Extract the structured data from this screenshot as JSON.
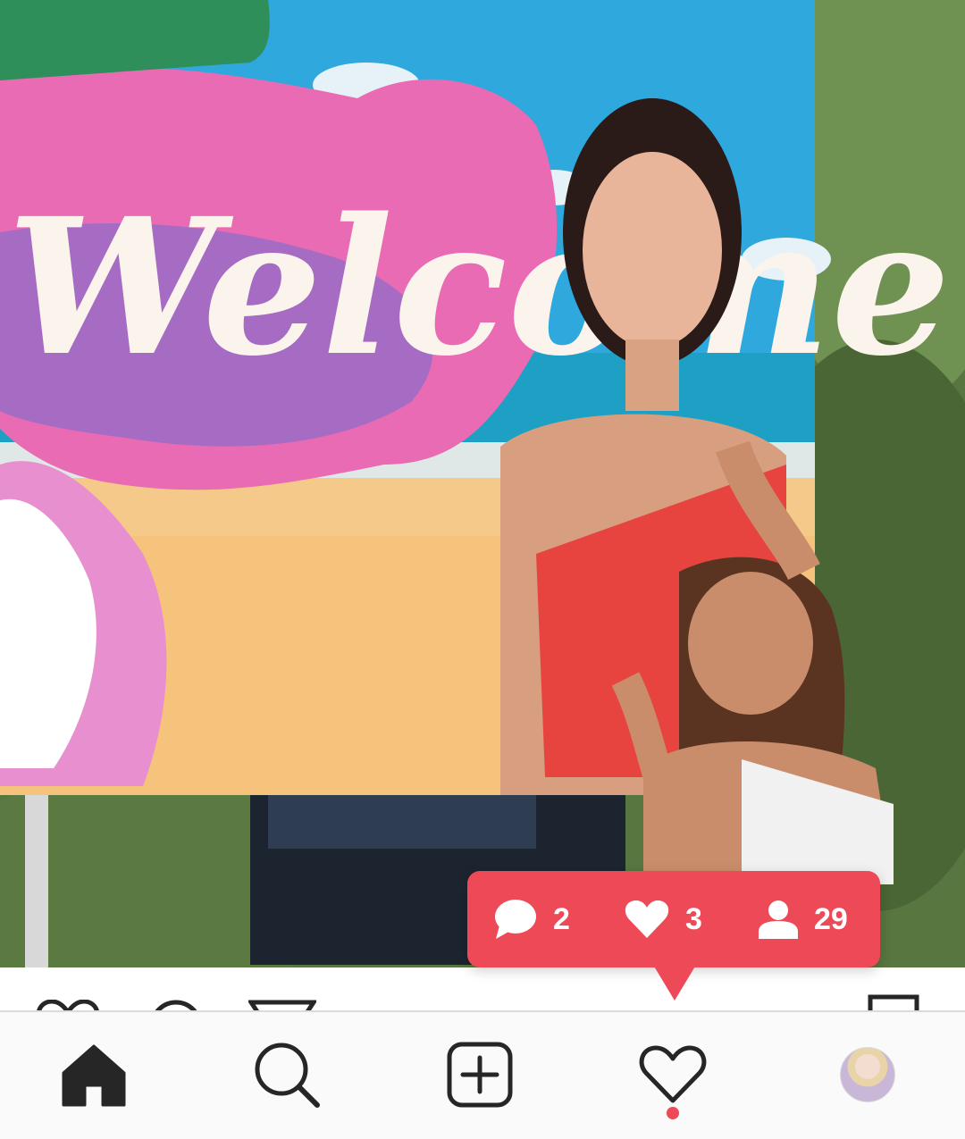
{
  "photo": {
    "sign_text": "Welcome",
    "colors": {
      "sky": "#2ea8dd",
      "sea": "#1e9fc4",
      "sand": "#f4c98a",
      "pink_splash": "#e86bb4",
      "purple_splash": "#9a6cc5",
      "swimsuit_red": "#e8443f",
      "foliage": "#58763f"
    }
  },
  "activity_popup": {
    "background": "#ed4956",
    "comments": {
      "icon": "comment-icon",
      "count": "2"
    },
    "likes": {
      "icon": "heart-icon",
      "count": "3"
    },
    "followers": {
      "icon": "person-icon",
      "count": "29"
    }
  },
  "action_row": {
    "icons": [
      "heart-icon",
      "comment-icon",
      "share-icon",
      "bookmark-icon"
    ]
  },
  "tab_bar": {
    "tabs": [
      {
        "name": "home",
        "icon": "home-icon",
        "active": true
      },
      {
        "name": "search",
        "icon": "search-icon",
        "active": false
      },
      {
        "name": "new-post",
        "icon": "add-post-icon",
        "active": false
      },
      {
        "name": "activity",
        "icon": "heart-outline-icon",
        "active": false,
        "has_notification": true
      },
      {
        "name": "profile",
        "icon": "avatar",
        "active": false
      }
    ],
    "notification_color": "#ed4956"
  }
}
